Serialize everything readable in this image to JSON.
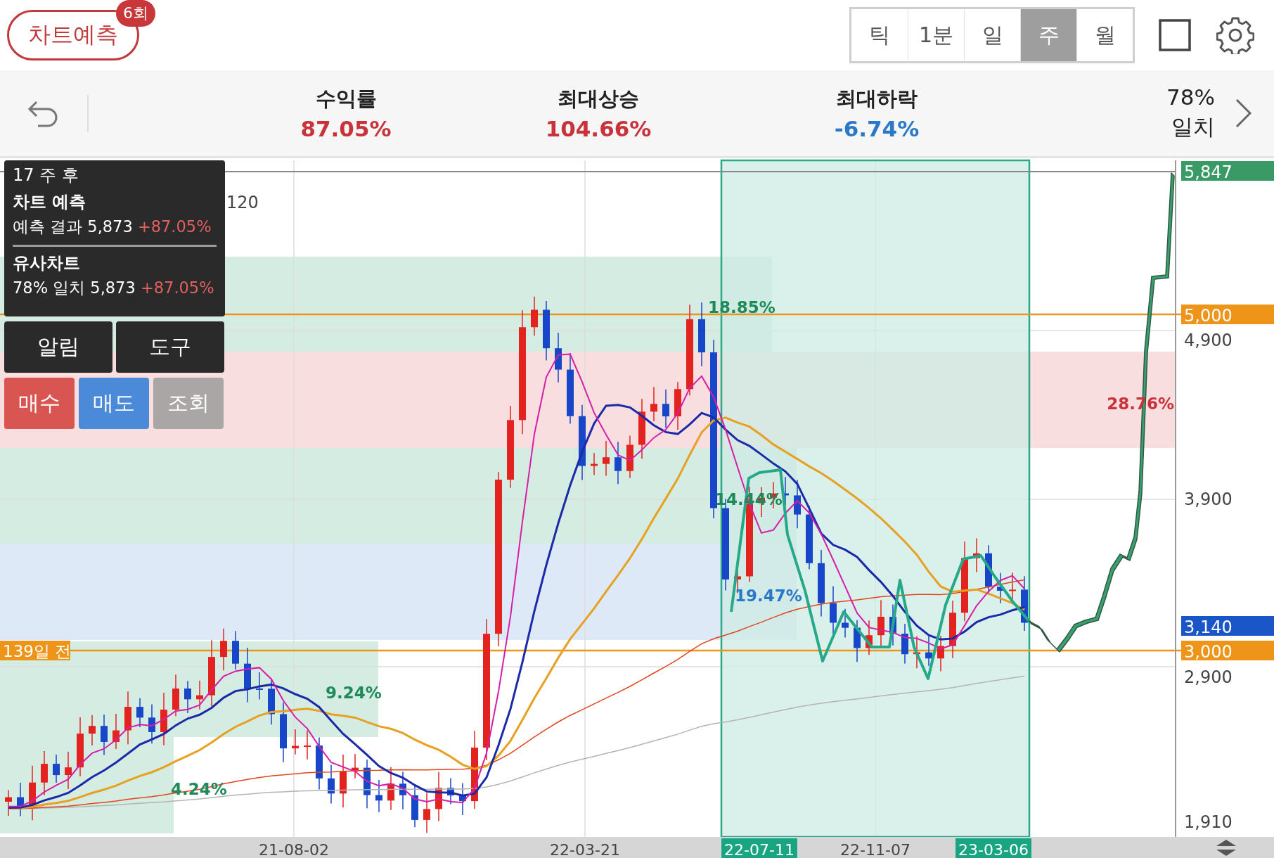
{
  "header": {
    "title": "차트예측",
    "badge": "6회",
    "periods": [
      {
        "label": "틱",
        "selected": false
      },
      {
        "label": "1분",
        "selected": false
      },
      {
        "label": "일",
        "selected": false
      },
      {
        "label": "주",
        "selected": true
      },
      {
        "label": "월",
        "selected": false
      }
    ]
  },
  "stats": {
    "items": [
      {
        "label": "수익률",
        "value": "87.05%",
        "color": "#c8323a"
      },
      {
        "label": "최대상승",
        "value": "104.66%",
        "color": "#c8323a"
      },
      {
        "label": "최대하락",
        "value": "-6.74%",
        "color": "#2a78c8"
      }
    ],
    "match": {
      "percent": "78%",
      "label": "일치"
    }
  },
  "chart": {
    "legend": [
      {
        "label": "120"
      }
    ],
    "zones": [
      {
        "label": "18.85%",
        "color": "#1e8a5a"
      },
      {
        "label": "28.76%",
        "color": "#c8323a"
      },
      {
        "label": "14.44%",
        "color": "#1e8a5a"
      },
      {
        "label": "19.47%",
        "color": "#2a78c8"
      },
      {
        "label": "9.24%",
        "color": "#1e8a5a"
      },
      {
        "label": "4.24%",
        "color": "#1e8a5a"
      }
    ],
    "ago_label": "139일 전",
    "price_ticks": [
      "4,900",
      "3,900",
      "2,900",
      "1,910"
    ],
    "price_tags": [
      {
        "label": "5,847",
        "color": "#3a9a66"
      },
      {
        "label": "5,000",
        "color": "#ee9418"
      },
      {
        "label": "3,140",
        "color": "#1a56c8"
      },
      {
        "label": "3,000",
        "color": "#ee9418"
      }
    ],
    "dates": [
      {
        "label": "21-08-02",
        "highlighted": false
      },
      {
        "label": "22-03-21",
        "highlighted": false
      },
      {
        "label": "22-07-11",
        "highlighted": true
      },
      {
        "label": "22-11-07",
        "highlighted": false
      },
      {
        "label": "23-03-06",
        "highlighted": true
      }
    ]
  },
  "popup": {
    "title": "17 주 후",
    "sections": [
      {
        "heading": "차트 예측",
        "label": "예측 결과",
        "price": "5,873",
        "change": "+87.05%"
      },
      {
        "heading": "유사차트",
        "label": "78% 일치",
        "price": "5,873",
        "change": "+87.05%"
      }
    ],
    "tools": [
      "알림",
      "도구"
    ],
    "orders": [
      {
        "label": "매수",
        "kind": "buy"
      },
      {
        "label": "매도",
        "kind": "sell"
      },
      {
        "label": "조회",
        "kind": "view"
      }
    ]
  }
}
